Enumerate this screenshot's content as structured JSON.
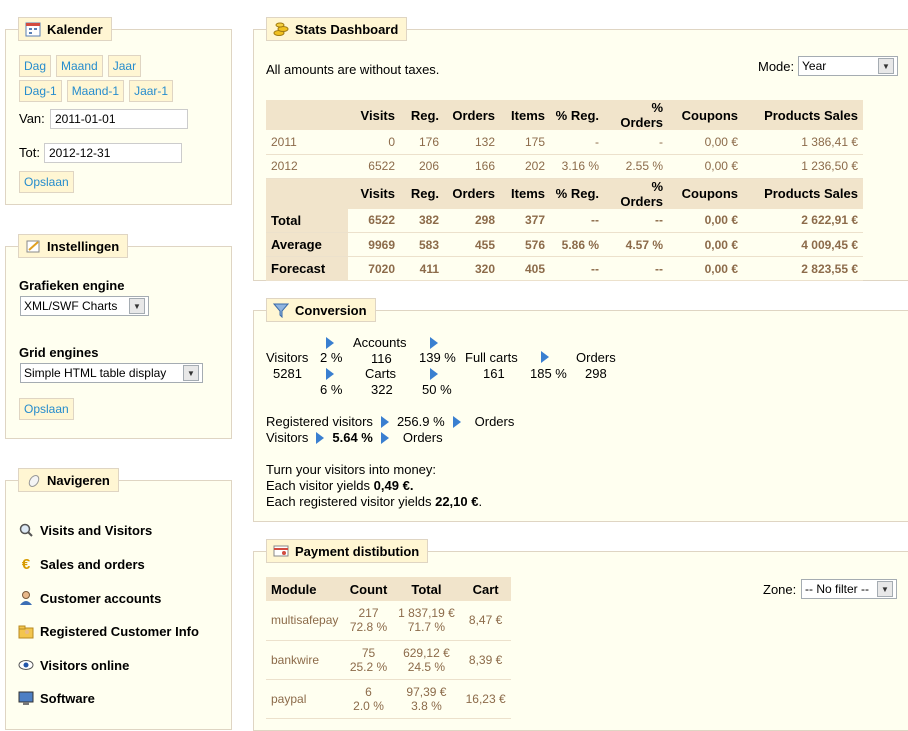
{
  "calendar": {
    "title": "Kalender",
    "buttons_row1": [
      "Dag",
      "Maand",
      "Jaar"
    ],
    "buttons_row2": [
      "Dag-1",
      "Maand-1",
      "Jaar-1"
    ],
    "from_label": "Van:",
    "from_value": "2011-01-01",
    "to_label": "Tot:",
    "to_value": "2012-12-31",
    "save_label": "Opslaan"
  },
  "settings": {
    "title": "Instellingen",
    "graph_label": "Grafieken engine",
    "graph_value": "XML/SWF Charts",
    "grid_label": "Grid engines",
    "grid_value": "Simple HTML table display",
    "save_label": "Opslaan"
  },
  "navigate": {
    "title": "Navigeren",
    "items": [
      {
        "label": "Visits and Visitors",
        "icon": "magnifier-icon"
      },
      {
        "label": "Sales and orders",
        "icon": "euro-icon"
      },
      {
        "label": "Customer accounts",
        "icon": "user-icon"
      },
      {
        "label": "Registered Customer Info",
        "icon": "folder-user-icon"
      },
      {
        "label": "Visitors online",
        "icon": "eye-icon"
      },
      {
        "label": "Software",
        "icon": "monitor-icon"
      }
    ]
  },
  "stats": {
    "title": "Stats Dashboard",
    "note": "All amounts are without taxes.",
    "mode_label": "Mode:",
    "mode_value": "Year",
    "headers": [
      "",
      "Visits",
      "Reg.",
      "Orders",
      "Items",
      "% Reg.",
      "% Orders",
      "Coupons",
      "Products Sales"
    ],
    "rows": [
      [
        "2011",
        "0",
        "176",
        "132",
        "175",
        "-",
        "-",
        "0,00 €",
        "1 386,41 €"
      ],
      [
        "2012",
        "6522",
        "206",
        "166",
        "202",
        "3.16 %",
        "2.55 %",
        "0,00 €",
        "1 236,50 €"
      ]
    ],
    "summary": [
      [
        "Total",
        "6522",
        "382",
        "298",
        "377",
        "--",
        "--",
        "0,00 €",
        "2 622,91 €"
      ],
      [
        "Average",
        "9969",
        "583",
        "455",
        "576",
        "5.86 %",
        "4.57 %",
        "0,00 €",
        "4 009,45 €"
      ],
      [
        "Forecast",
        "7020",
        "411",
        "320",
        "405",
        "--",
        "--",
        "0,00 €",
        "2 823,55 €"
      ]
    ]
  },
  "conversion": {
    "title": "Conversion",
    "visitors_label": "Visitors",
    "visitors_value": "5281",
    "accounts_label": "Accounts",
    "accounts_value": "116",
    "pct_visitors_accounts": "2 %",
    "pct_accounts_fullcarts": "139 %",
    "carts_label": "Carts",
    "carts_value": "322",
    "pct_visitors_carts": "6 %",
    "pct_carts_fullcarts": "50 %",
    "fullcarts_label": "Full carts",
    "fullcarts_value": "161",
    "pct_fullcarts_orders": "185 %",
    "orders_label": "Orders",
    "orders_value": "298",
    "reg_visitors_label": "Registered visitors",
    "reg_pct": "256.9 %",
    "reg_orders_label": "Orders",
    "visitors2_label": "Visitors",
    "visitors2_pct": "5.64 %",
    "visitors2_orders_label": "Orders",
    "money_line": "Turn your visitors into money:",
    "yield_visitor_text": "Each visitor yields",
    "yield_visitor_value": "0,49 €.",
    "yield_reg_text": "Each registered visitor yields",
    "yield_reg_value": "22,10 €",
    "yield_reg_tail": "."
  },
  "payment": {
    "title": "Payment distibution",
    "zone_label": "Zone:",
    "zone_value": "-- No filter --",
    "headers": [
      "Module",
      "Count",
      "Total",
      "Cart"
    ],
    "rows": [
      {
        "module": "multisafepay",
        "count": "217",
        "count_pct": "72.8 %",
        "total": "1 837,19 €",
        "total_pct": "71.7 %",
        "cart": "8,47 €"
      },
      {
        "module": "bankwire",
        "count": "75",
        "count_pct": "25.2 %",
        "total": "629,12 €",
        "total_pct": "24.5 %",
        "cart": "8,39 €"
      },
      {
        "module": "paypal",
        "count": "6",
        "count_pct": "2.0 %",
        "total": "97,39 €",
        "total_pct": "3.8 %",
        "cart": "16,23 €"
      }
    ]
  }
}
